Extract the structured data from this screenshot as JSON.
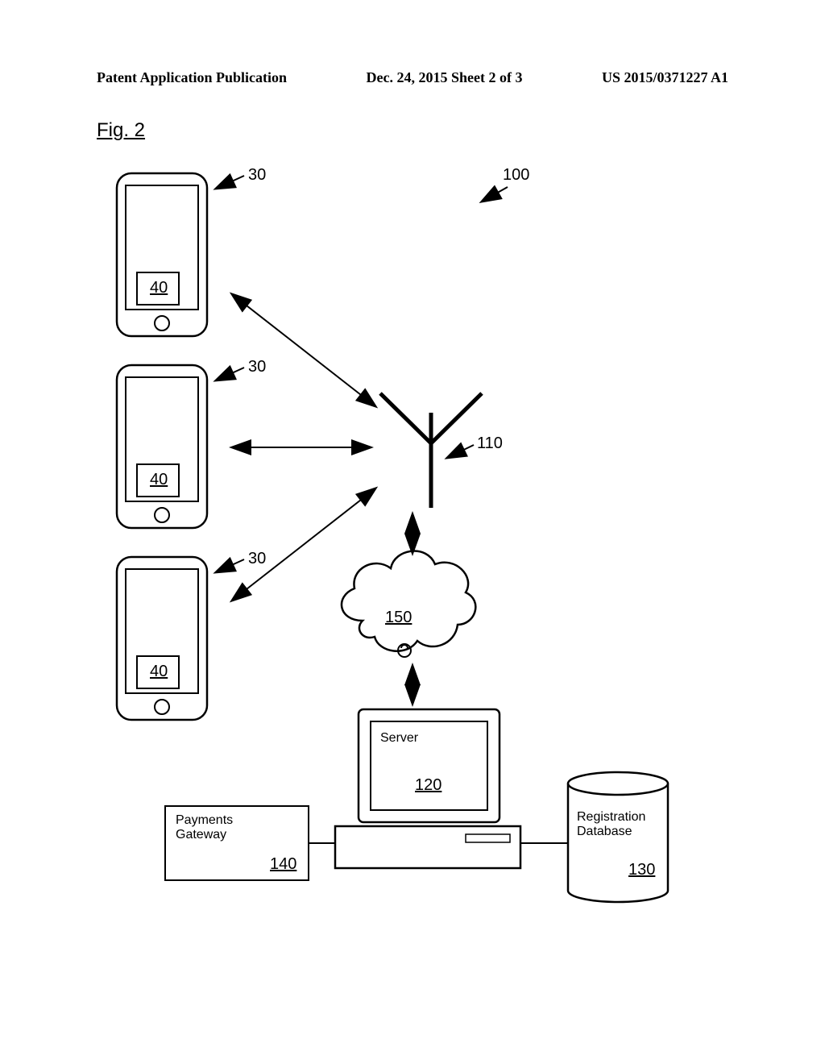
{
  "header": {
    "left": "Patent Application Publication",
    "center": "Dec. 24, 2015   Sheet 2 of 3",
    "right": "US 2015/0371227 A1"
  },
  "figure": {
    "label": "Fig. 2",
    "refs": {
      "phone1": "30",
      "phone2": "30",
      "phone3": "30",
      "card1": "40",
      "card2": "40",
      "card3": "40",
      "system": "100",
      "antenna": "110",
      "cloud": "150",
      "server_label": "Server",
      "server_num": "120",
      "payments_label": "Payments\nGateway",
      "payments_num": "140",
      "regdb_label": "Registration\nDatabase",
      "regdb_num": "130"
    }
  }
}
